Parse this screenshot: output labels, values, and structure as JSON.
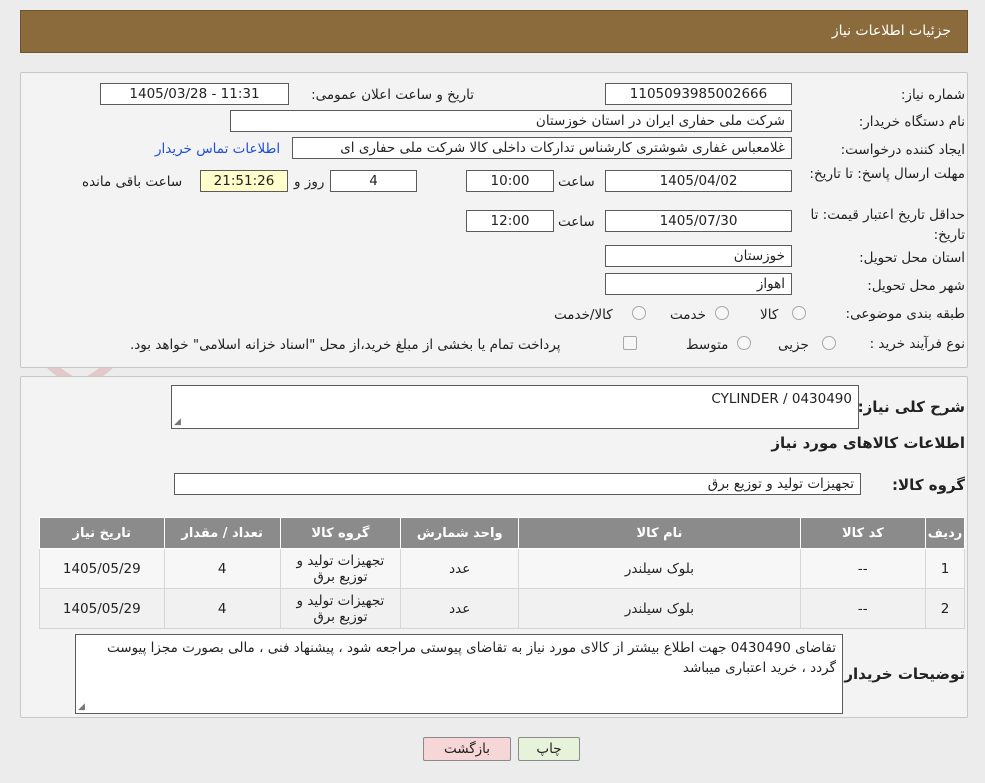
{
  "header": {
    "title": "جزئیات اطلاعات نیاز"
  },
  "form": {
    "need_number": {
      "label": "شماره نیاز:",
      "value": "1105093985002666"
    },
    "announce_datetime": {
      "label": "تاریخ و ساعت اعلان عمومی:",
      "value": "1405/03/28 - 11:31"
    },
    "buyer_org": {
      "label": "نام دستگاه خریدار:",
      "value": "شرکت ملی حفاری ایران در استان خوزستان"
    },
    "requester": {
      "label": "ایجاد کننده درخواست:",
      "value": "غلامعباس غفاری شوشتری کارشناس تدارکات داخلی کالا شرکت ملی حفاری ای",
      "contact_link": "اطلاعات تماس خریدار"
    },
    "reply_deadline": {
      "label": "مهلت ارسال پاسخ: تا تاریخ:",
      "date": "1405/04/02",
      "time_label": "ساعت",
      "time": "10:00",
      "days": "4",
      "days_label": "روز و",
      "remaining": "21:51:26",
      "remaining_label": "ساعت باقی مانده"
    },
    "price_validity": {
      "label": "حداقل تاریخ اعتبار قیمت: تا تاریخ:",
      "date": "1405/07/30",
      "time_label": "ساعت",
      "time": "12:00"
    },
    "province": {
      "label": "استان محل تحویل:",
      "value": "خوزستان"
    },
    "city": {
      "label": "شهر محل تحویل:",
      "value": "اهواز"
    },
    "category": {
      "label": "طبقه بندی موضوعی:",
      "options": [
        "کالا",
        "خدمت",
        "کالا/خدمت"
      ]
    },
    "process": {
      "label": "نوع فرآیند خرید :",
      "options": [
        "جزیی",
        "متوسط"
      ],
      "payment_note": "پرداخت تمام یا بخشی از مبلغ خرید،از محل \"اسناد خزانه اسلامی\" خواهد بود."
    }
  },
  "description": {
    "label": "شرح کلی نیاز:",
    "value": "CYLINDER  /  0430490"
  },
  "items_section": {
    "title": "اطلاعات کالاهای مورد نیاز",
    "group_label": "گروه کالا:",
    "group_value": "تجهیزات تولید و توزیع برق",
    "columns": [
      "ردیف",
      "کد کالا",
      "نام کالا",
      "واحد شمارش",
      "گروه کالا",
      "تعداد / مقدار",
      "تاریخ نیاز"
    ],
    "rows": [
      {
        "row": "1",
        "code": "--",
        "name": "بلوک سیلندر",
        "unit": "عدد",
        "group": "تجهیزات تولید و توزیع برق",
        "qty": "4",
        "date": "1405/05/29"
      },
      {
        "row": "2",
        "code": "--",
        "name": "بلوک سیلندر",
        "unit": "عدد",
        "group": "تجهیزات تولید و توزیع برق",
        "qty": "4",
        "date": "1405/05/29"
      }
    ]
  },
  "buyer_notes": {
    "label": "توضیحات خریدار:",
    "value": "تقاضای 0430490 جهت اطلاع بیشتر از کالای مورد نیاز به تقاضای پیوستی مراجعه شود ، پیشنهاد فنی ، مالی بصورت مجزا پیوست گردد ، خرید اعتباری میباشد"
  },
  "buttons": {
    "print": "چاپ",
    "back": "بازگشت"
  },
  "watermark": {
    "text": "AriaTender.neT"
  },
  "colors": {
    "header": "#8b6a3c",
    "table_header": "#8b8b8b",
    "link": "#1f4fd6",
    "back_button": "#f6d6d6",
    "print_button": "#e6f2da",
    "remaining_box": "#ffffcc"
  }
}
